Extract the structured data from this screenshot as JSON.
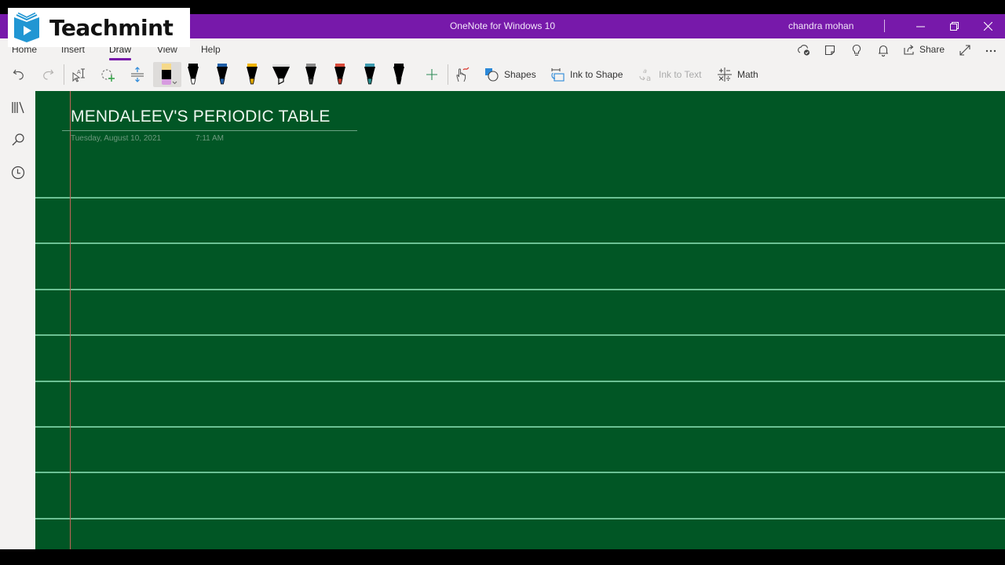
{
  "window": {
    "title": "OneNote for Windows 10",
    "user": "chandra mohan",
    "controls": [
      "minimize",
      "restore",
      "close"
    ]
  },
  "logo": {
    "text": "Teachmint",
    "color": "#2196d3"
  },
  "ribbon": {
    "tabs": [
      {
        "label": "Home",
        "active": false
      },
      {
        "label": "Insert",
        "active": false
      },
      {
        "label": "Draw",
        "active": true
      },
      {
        "label": "View",
        "active": false
      },
      {
        "label": "Help",
        "active": false
      }
    ],
    "top_right": {
      "icons": [
        "sync-status-icon",
        "sticky-notes-icon",
        "tell-me-icon",
        "notifications-icon"
      ],
      "share_label": "Share"
    },
    "tools": {
      "shapes_label": "Shapes",
      "ink_to_shape_label": "Ink to Shape",
      "ink_to_text_label": "Ink to Text",
      "math_label": "Math"
    },
    "pens": [
      {
        "name": "highlighter-eraser-selected",
        "band": "#f6d98a",
        "tip": "#d79be0"
      },
      {
        "name": "pen-black",
        "band": "#000000",
        "tip": "#ffffff"
      },
      {
        "name": "pen-blue",
        "band": "#1f5fa8",
        "tip": "#1f5fa8"
      },
      {
        "name": "pen-yellow",
        "band": "#f0b400",
        "tip": "#e0a800"
      },
      {
        "name": "highlighter-black",
        "band": "#000000",
        "tip": "#ffffff"
      },
      {
        "name": "pen-galaxy-gray",
        "band": "#8a8a8a",
        "tip": "#444444"
      },
      {
        "name": "pen-rainbow",
        "band": "#d94a3a",
        "tip": "#c0392b"
      },
      {
        "name": "pen-ocean",
        "band": "#3c9bb0",
        "tip": "#2a8a8a"
      },
      {
        "name": "pen-black-2",
        "band": "#000000",
        "tip": "#000000"
      }
    ],
    "accent": "#7719aa"
  },
  "leftnav": {
    "items": [
      "notebooks-icon",
      "search-icon",
      "recent-icon"
    ]
  },
  "page": {
    "title": "MENDALEEV'S PERIODIC TABLE",
    "date": "Tuesday, August 10, 2021",
    "time": "7:11 AM",
    "background": "#015625",
    "rule_color": "#7fd3a8",
    "margin_color": "#c0645a"
  }
}
